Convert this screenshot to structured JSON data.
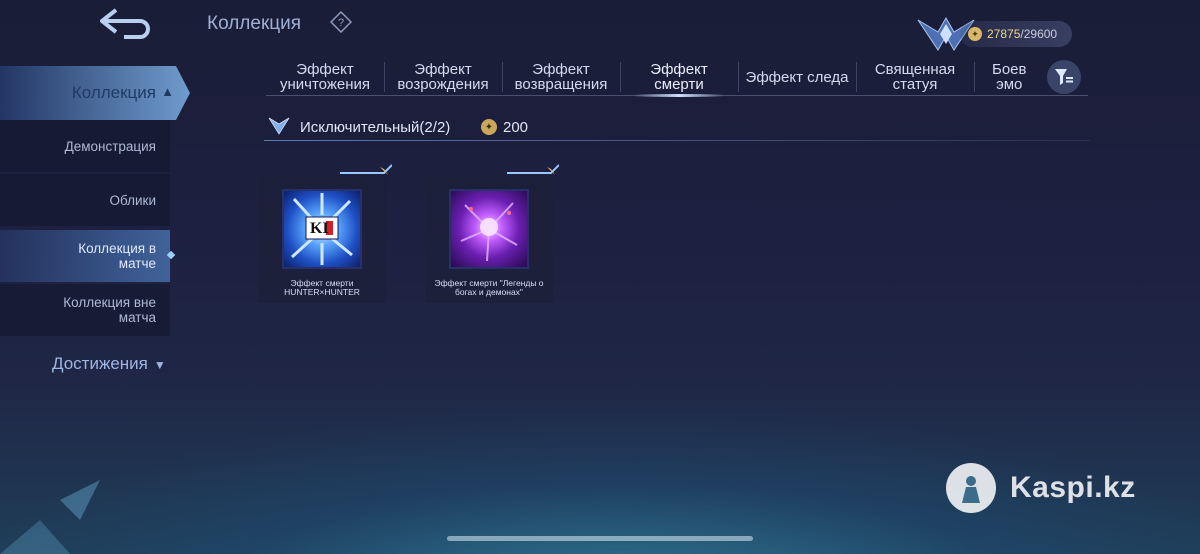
{
  "header": {
    "title": "Коллекция",
    "currency_value": "27875",
    "currency_separator": "/",
    "currency_max": "29600"
  },
  "sidebar": {
    "main_label": "Коллекция",
    "items": [
      {
        "label": "Демонстрация"
      },
      {
        "label": "Облики"
      },
      {
        "label_line1": "Коллекция в",
        "label_line2": "матче",
        "active": true
      },
      {
        "label_line1": "Коллекция вне",
        "label_line2": "матча"
      }
    ],
    "achievements_label": "Достижения"
  },
  "tabs": [
    {
      "line1": "Эффект",
      "line2": "уничтожения"
    },
    {
      "line1": "Эффект",
      "line2": "возрождения"
    },
    {
      "line1": "Эффект",
      "line2": "возвращения"
    },
    {
      "line1": "Эффект",
      "line2": "смерти",
      "active": true
    },
    {
      "line1": "Эффект следа",
      "line2": ""
    },
    {
      "line1": "Священная",
      "line2": "статуя"
    },
    {
      "line1": "Боев",
      "line2": "эмо"
    }
  ],
  "section": {
    "title": "Исключительный(2/2)",
    "count": "200"
  },
  "cards": [
    {
      "thumb_text": "KI",
      "label_line1": "Эффект смерти",
      "label_line2": "HUNTER×HUNTER"
    },
    {
      "label_line1": "Эффект смерти \"Легенды о",
      "label_line2": "богах и демонах\""
    }
  ],
  "watermark": "Kaspi.kz",
  "colors": {
    "accent_gold": "#f0d58a",
    "tab_active_underline": "#cfe0ff",
    "sidebar_active": "#78aee0"
  }
}
